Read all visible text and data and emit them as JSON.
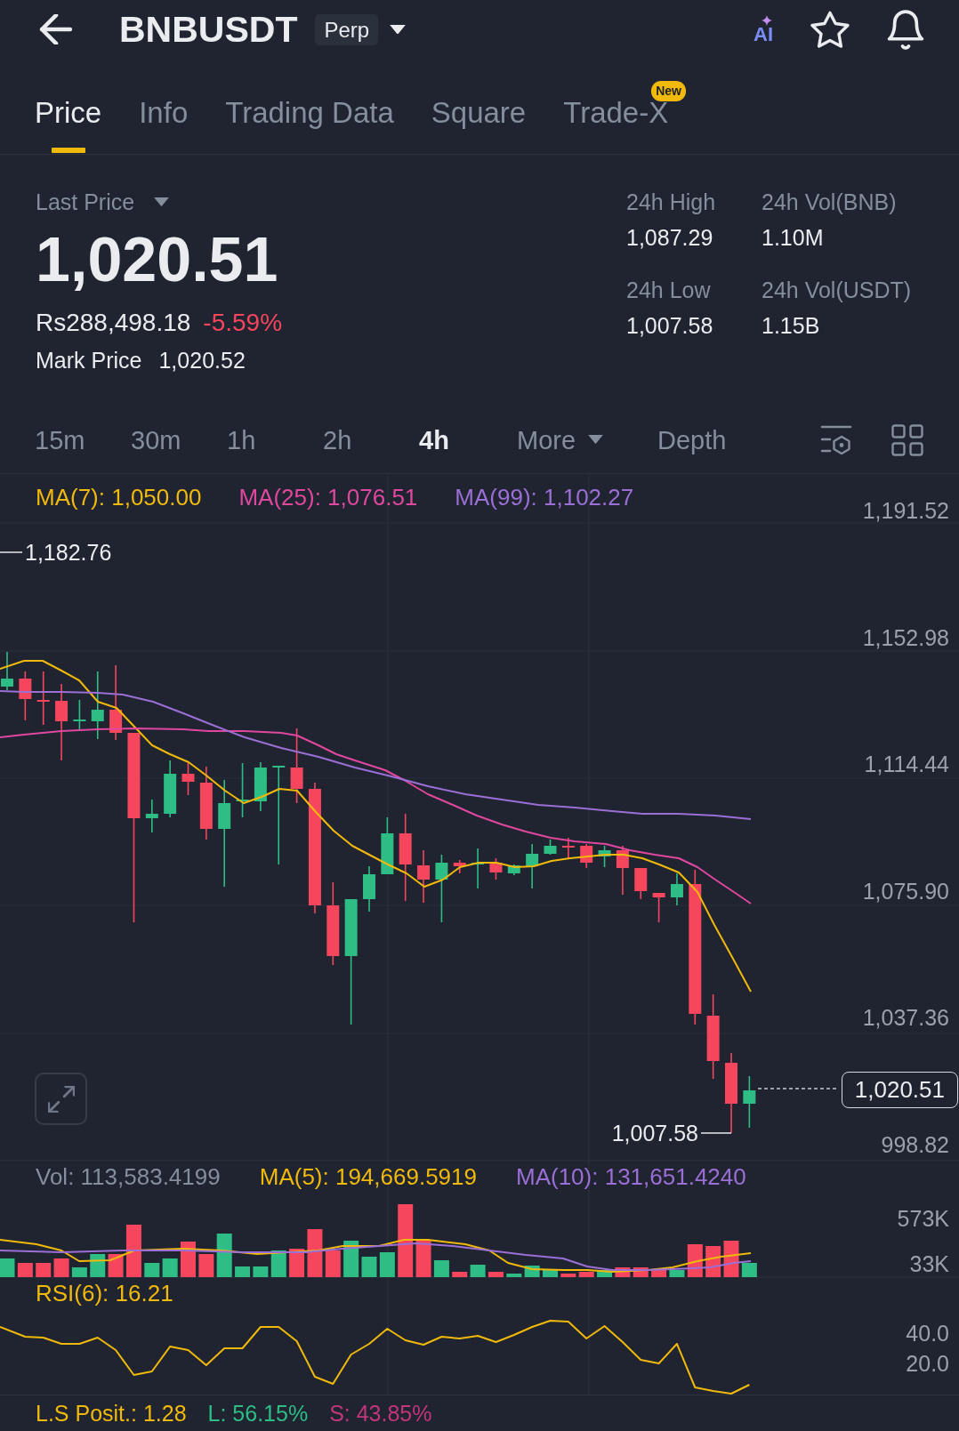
{
  "header": {
    "title": "BNBUSDT",
    "badge": "Perp",
    "ai_label": "AI"
  },
  "tabs": [
    {
      "label": "Price",
      "selected": true
    },
    {
      "label": "Info",
      "selected": false
    },
    {
      "label": "Trading Data",
      "selected": false
    },
    {
      "label": "Square",
      "selected": false
    },
    {
      "label": "Trade-X",
      "selected": false,
      "badge": "New"
    }
  ],
  "ticker": {
    "last_price_label": "Last Price",
    "last_price": "1,020.51",
    "fiat_price": "Rs288,498.18",
    "change": "-5.59%",
    "mark_price_label": "Mark Price",
    "mark_price": "1,020.52"
  },
  "stats": [
    {
      "label": "24h High",
      "value": "1,087.29"
    },
    {
      "label": "24h Vol(BNB)",
      "value": "1.10M"
    },
    {
      "label": "24h Low",
      "value": "1,007.58"
    },
    {
      "label": "24h Vol(USDT)",
      "value": "1.15B"
    }
  ],
  "intervals": [
    {
      "label": "15m",
      "kind": "option",
      "selected": false
    },
    {
      "label": "30m",
      "kind": "option",
      "selected": false
    },
    {
      "label": "1h",
      "kind": "option",
      "selected": false
    },
    {
      "label": "2h",
      "kind": "option",
      "selected": false
    },
    {
      "label": "4h",
      "kind": "option",
      "selected": true
    },
    {
      "label": "More",
      "kind": "dropdown",
      "selected": false
    },
    {
      "label": "Depth",
      "kind": "option",
      "selected": false
    }
  ],
  "chart": {
    "ma_legend": [
      {
        "label": "MA(7): 1,050.00",
        "color": "#f0b90b"
      },
      {
        "label": "MA(25): 1,076.51",
        "color": "#e0479e"
      },
      {
        "label": "MA(99): 1,102.27",
        "color": "#9b6fd6"
      }
    ],
    "price_axis": [
      "1,191.52",
      "1,152.98",
      "1,114.44",
      "1,075.90",
      "1,037.36",
      "998.82"
    ],
    "high_marker": "1,182.76",
    "low_marker": "1,007.58",
    "current_price": "1,020.51",
    "volume_legend": [
      {
        "label": "Vol: 113,583.4199",
        "color": "#848e9c"
      },
      {
        "label": "MA(5): 194,669.5919",
        "color": "#f0b90b"
      },
      {
        "label": "MA(10): 131,651.4240",
        "color": "#9b6fd6"
      }
    ],
    "volume_axis": [
      "573K",
      "33K"
    ],
    "rsi_label": "RSI(6): 16.21",
    "rsi_axis": [
      "40.0",
      "20.0"
    ]
  },
  "position_ratio": [
    {
      "label": "L.S Posit.: 1.28",
      "color": "#f0b90b"
    },
    {
      "label": "L: 56.15%",
      "color": "#2ebd85"
    },
    {
      "label": "S: 43.85%",
      "color": "#c2357a"
    }
  ]
}
